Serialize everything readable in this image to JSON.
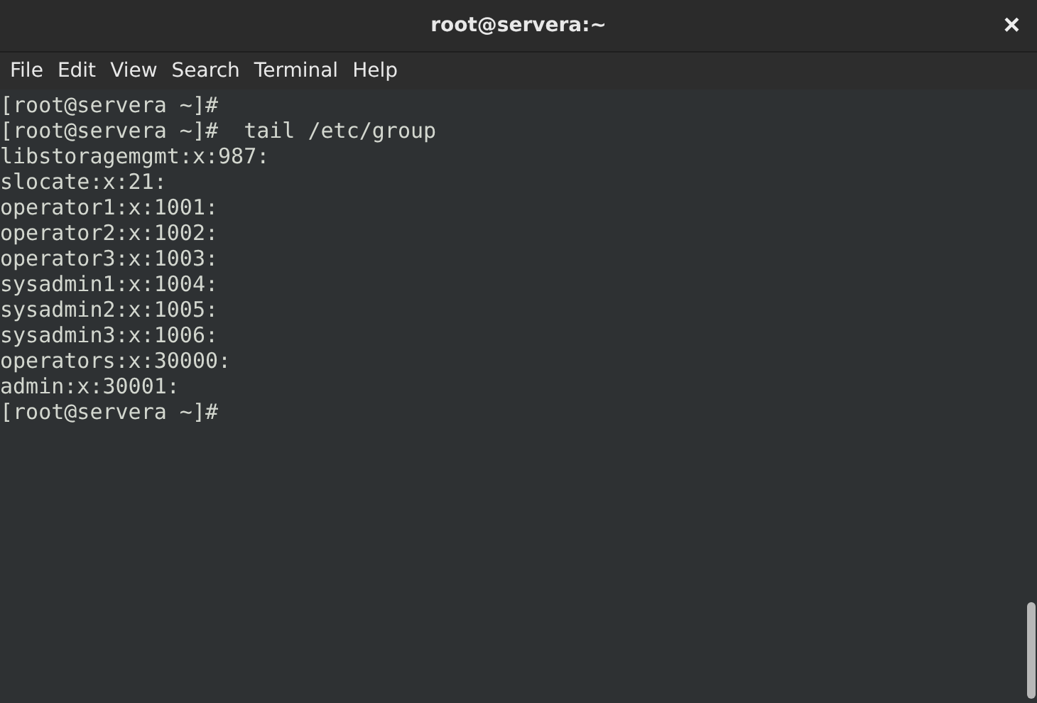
{
  "window": {
    "title": "root@servera:~",
    "close": "×"
  },
  "menu": [
    "File",
    "Edit",
    "View",
    "Search",
    "Terminal",
    "Help"
  ],
  "terminal": {
    "lines": [
      "[root@servera ~]#",
      "[root@servera ~]#  tail /etc/group",
      "libstoragemgmt:x:987:",
      "slocate:x:21:",
      "operator1:x:1001:",
      "operator2:x:1002:",
      "operator3:x:1003:",
      "sysadmin1:x:1004:",
      "sysadmin2:x:1005:",
      "sysadmin3:x:1006:",
      "operators:x:30000:",
      "admin:x:30001:",
      "[root@servera ~]#"
    ]
  }
}
